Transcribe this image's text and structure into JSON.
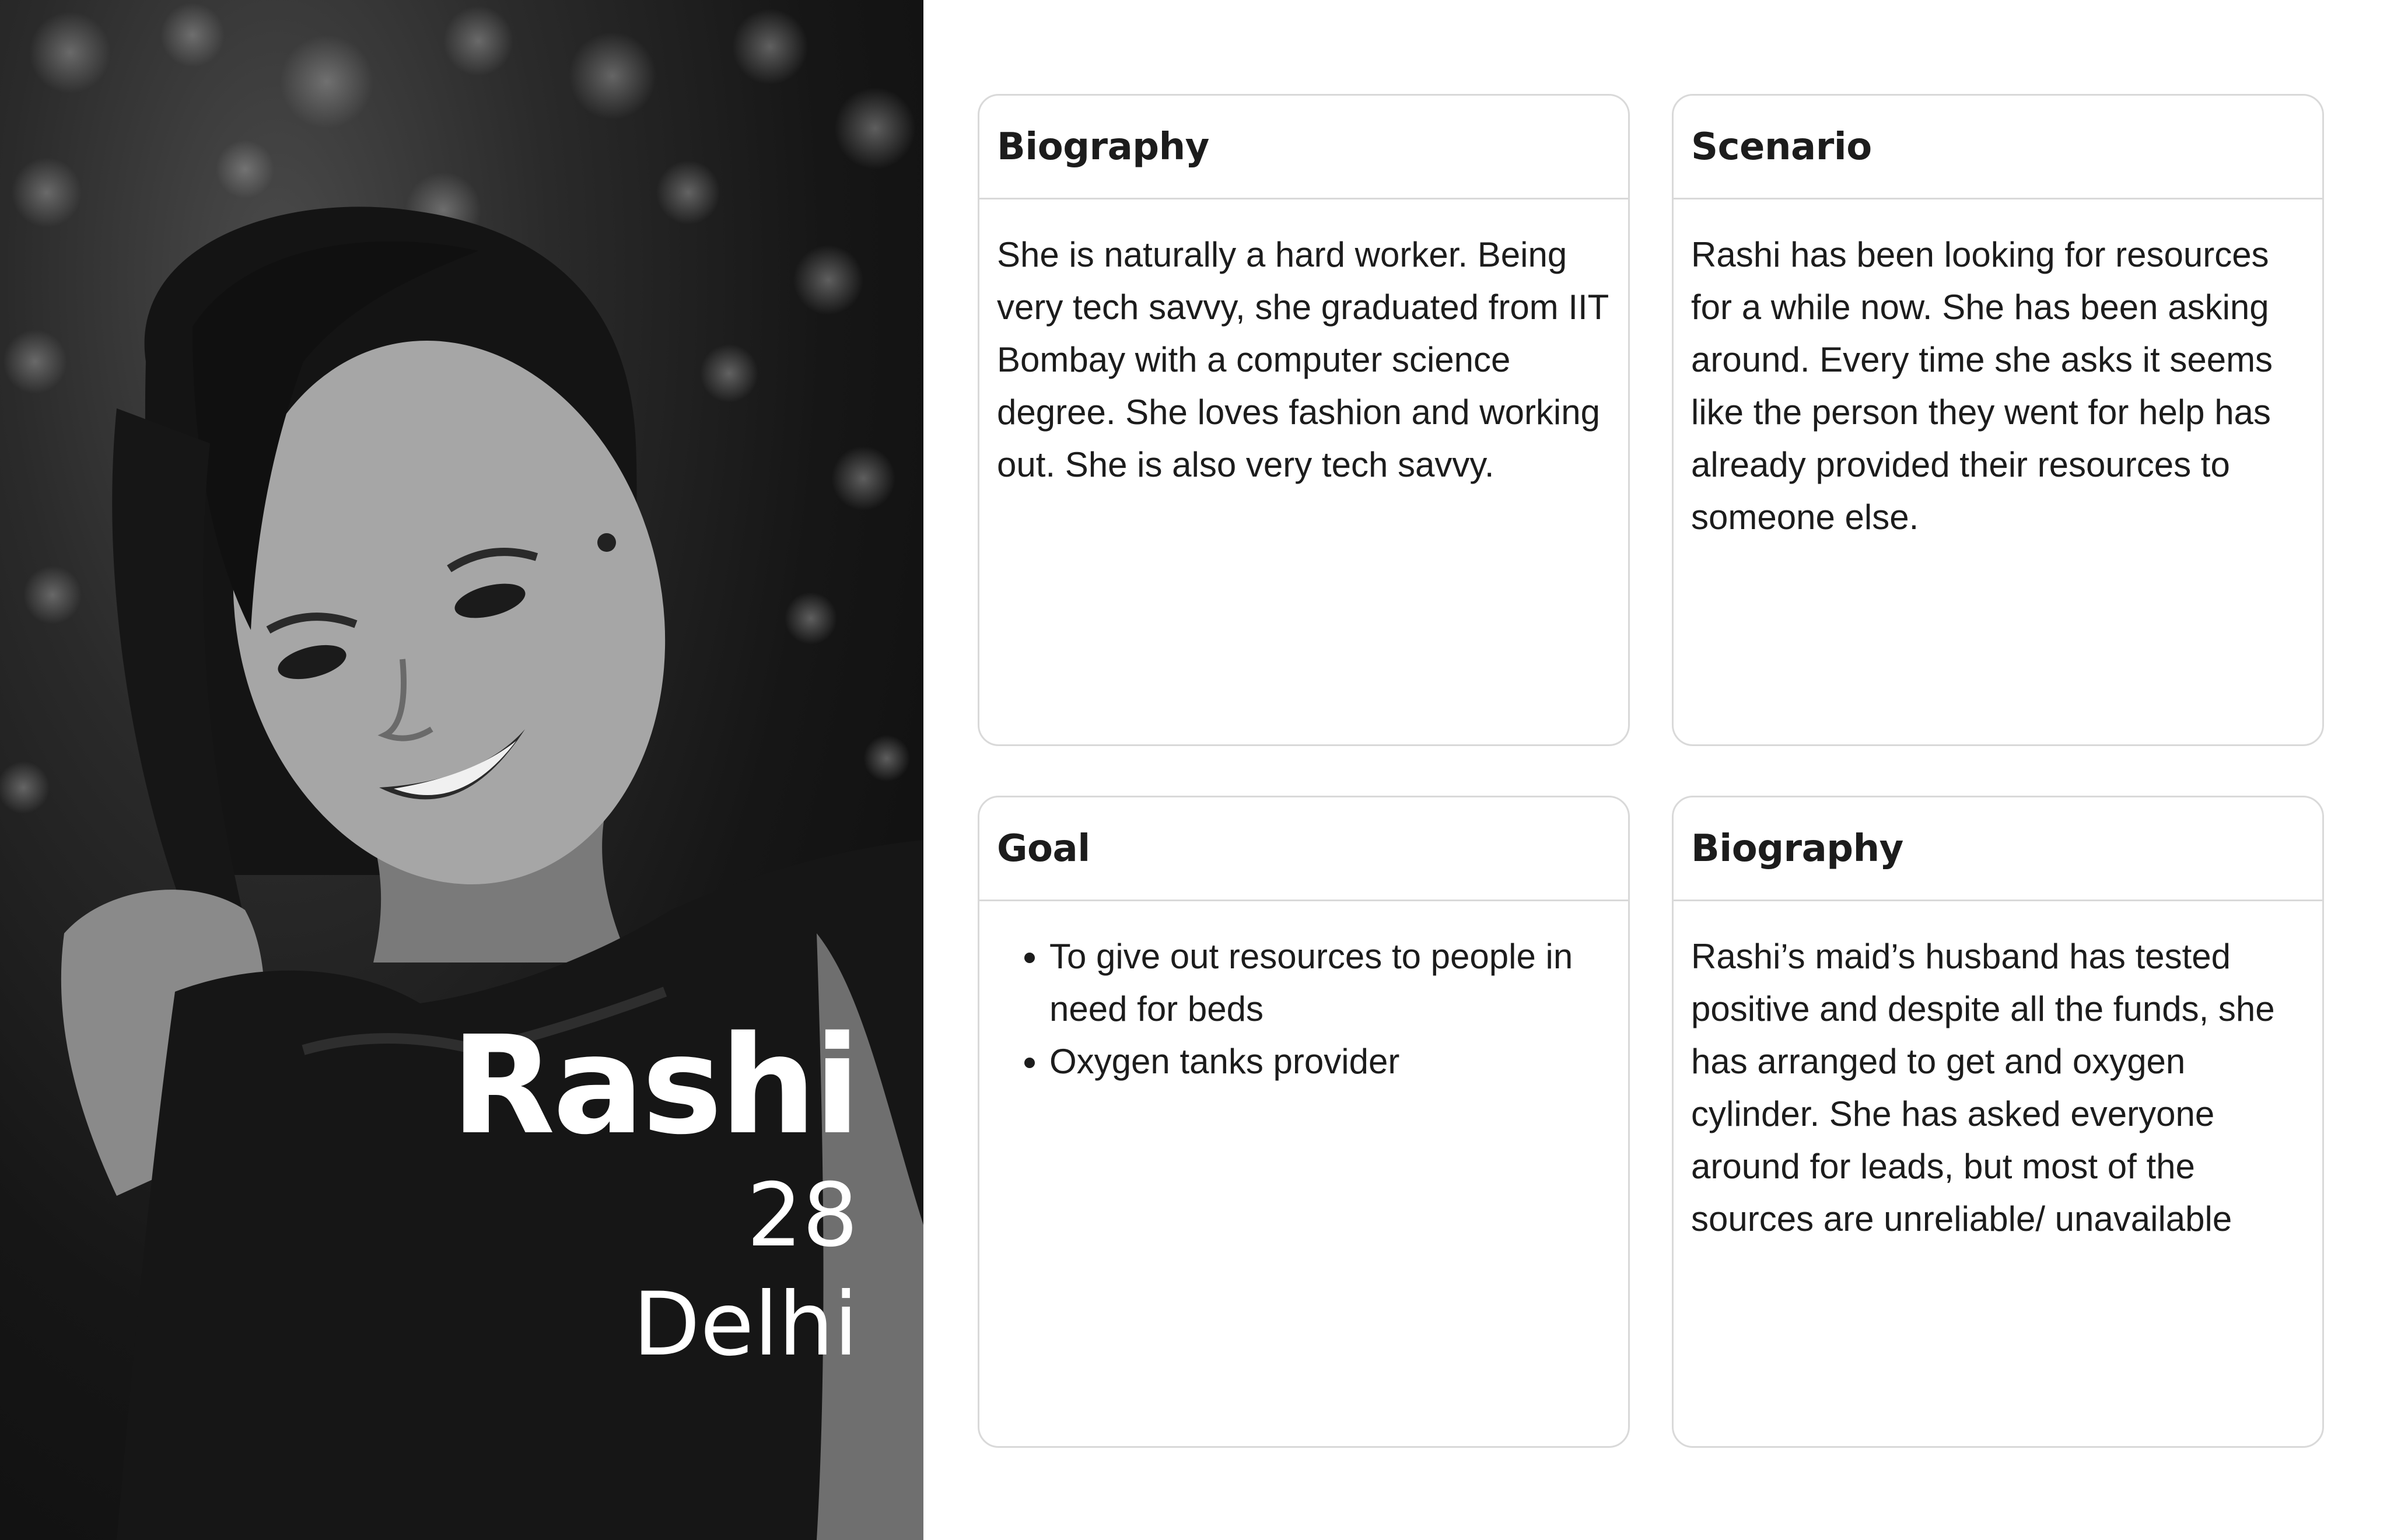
{
  "persona": {
    "name": "Rashi",
    "age": "28",
    "city": "Delhi"
  },
  "cards": {
    "biography_1": {
      "title": "Biography",
      "body": "She is naturally a hard worker. Being very tech savvy, she graduated from IIT Bombay with a computer science degree. She loves fashion and working out. She is also very tech savvy."
    },
    "scenario": {
      "title": "Scenario",
      "body": "Rashi has been looking for resources for a while now. She has been asking around. Every time she asks it seems like the person they went for help has already provided their resources to someone else."
    },
    "goal": {
      "title": "Goal",
      "items": [
        "To give out resources to people in need for beds",
        "Oxygen tanks provider"
      ]
    },
    "biography_2": {
      "title": "Biography",
      "body": "Rashi’s maid’s husband has tested positive and despite all the funds, she has arranged to get and oxygen cylinder. She has asked everyone around for leads, but most of the sources are unreliable/ unavailable"
    }
  }
}
